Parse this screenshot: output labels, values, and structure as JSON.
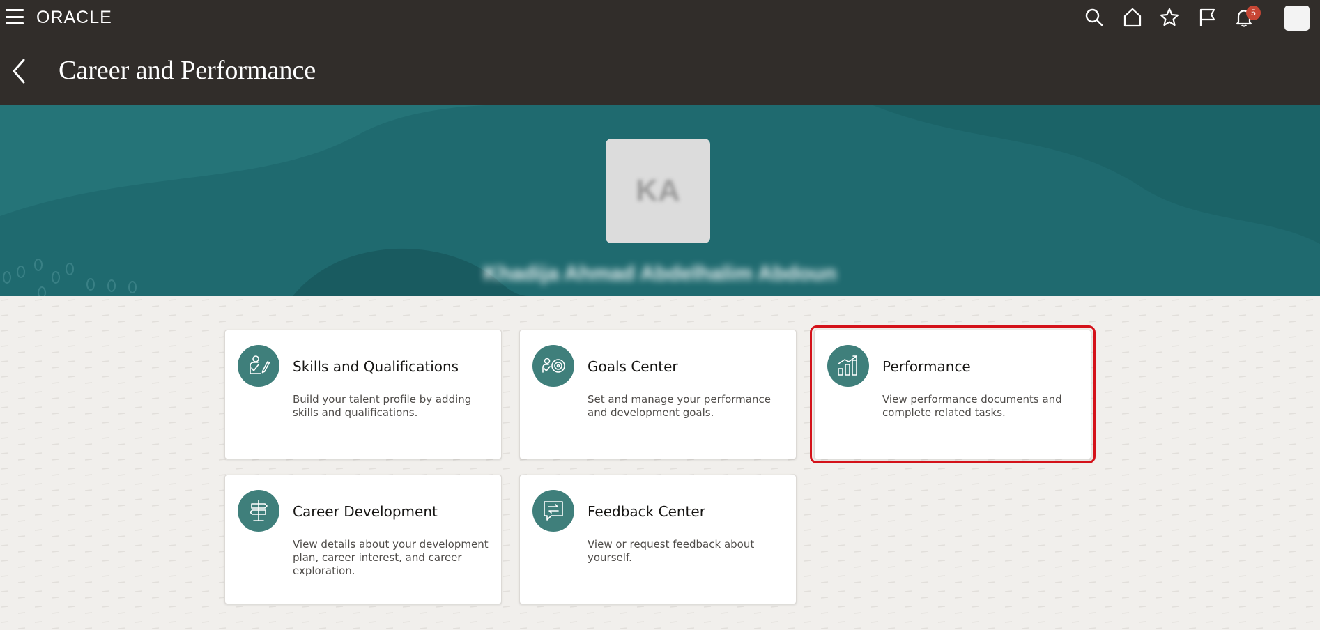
{
  "header": {
    "brand": "ORACLE",
    "notification_count": "5",
    "icons": [
      "menu-icon",
      "search-icon",
      "home-icon",
      "star-icon",
      "flag-icon",
      "bell-icon"
    ]
  },
  "page": {
    "title": "Career and Performance"
  },
  "profile": {
    "initials": "KA",
    "name": "Khadija Ahmad Abdelhalim Abdoun"
  },
  "colors": {
    "header_bg": "#312d2a",
    "banner_bg": "#1f6a6f",
    "icon_bg": "#3f7f7b",
    "badge": "#c74634",
    "highlight": "#d4121a"
  },
  "cards": [
    {
      "title": "Skills and Qualifications",
      "description": "Build your talent profile by adding skills and qualifications.",
      "icon": "skills-icon"
    },
    {
      "title": "Goals Center",
      "description": "Set and manage your performance and development goals.",
      "icon": "goals-icon"
    },
    {
      "title": "Performance",
      "description": "View performance documents and complete related tasks.",
      "icon": "performance-chart-icon"
    },
    {
      "title": "Career Development",
      "description": "View details about your development plan, career interest, and career exploration.",
      "icon": "signpost-icon"
    },
    {
      "title": "Feedback Center",
      "description": "View or request feedback about yourself.",
      "icon": "feedback-icon"
    }
  ]
}
